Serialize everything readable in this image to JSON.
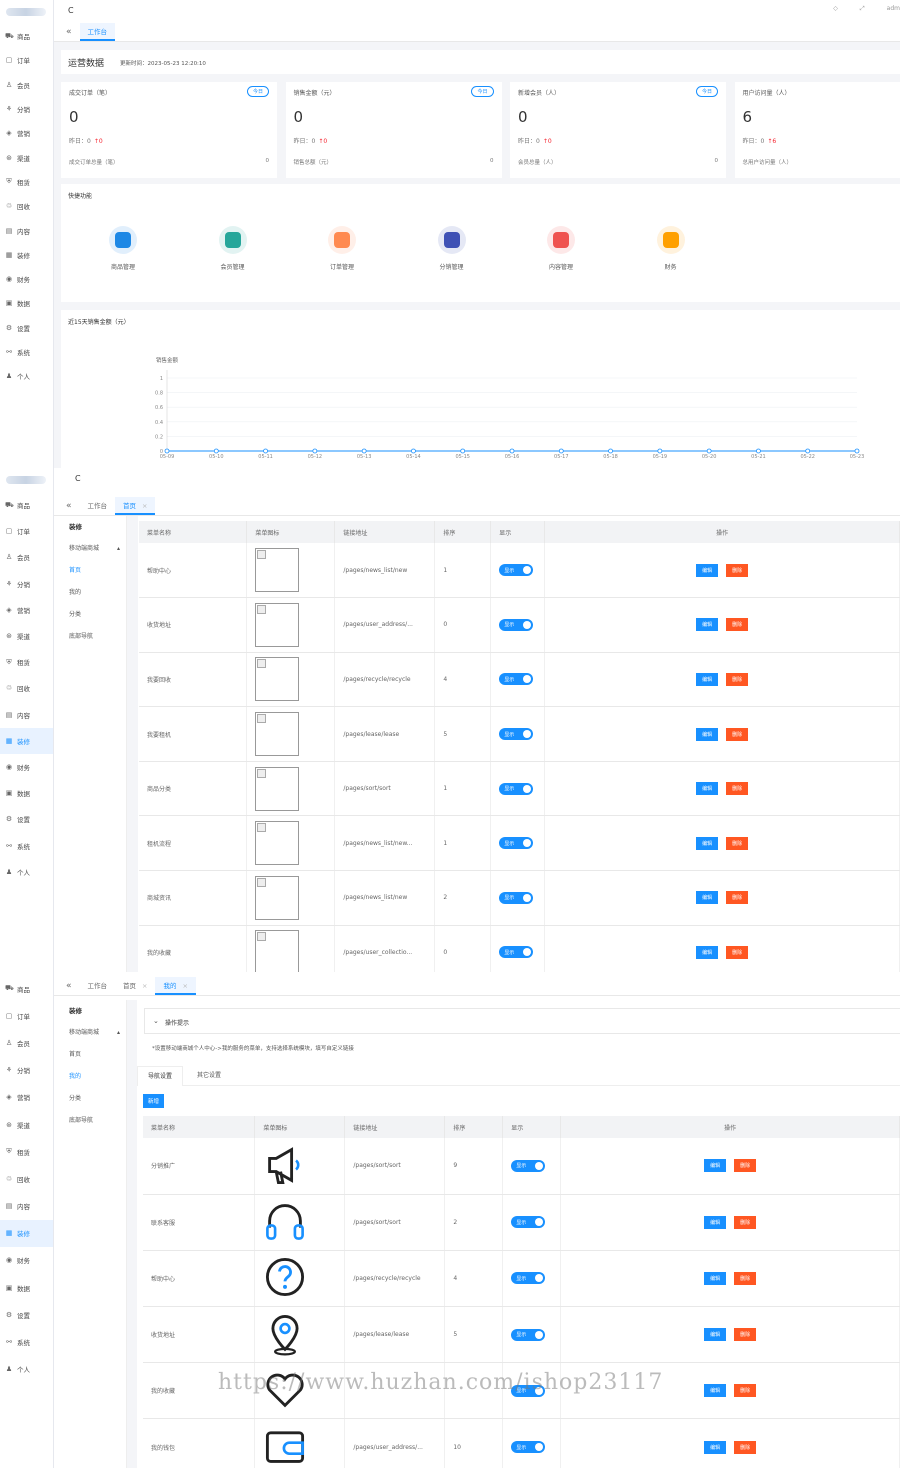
{
  "sidebar1": [
    "商品",
    "订单",
    "会员",
    "分销",
    "营销",
    "渠道",
    "租赁",
    "回收",
    "内容",
    "装修",
    "财务",
    "数据",
    "设置",
    "系统",
    "个人"
  ],
  "sidebar2": [
    "商品",
    "订单",
    "会员",
    "分销",
    "营销",
    "渠道",
    "租赁",
    "回收",
    "内容",
    "装修",
    "财务",
    "数据",
    "设置",
    "系统",
    "个人"
  ],
  "icons": [
    "cart-icon",
    "order-icon",
    "user-icon",
    "share-icon",
    "diamond-icon",
    "channel-icon",
    "shield-icon",
    "recycle-icon",
    "book-icon",
    "layout-icon",
    "wallet-icon",
    "data-icon",
    "gear-icon",
    "system-icon",
    "person-icon"
  ],
  "topbar": {
    "refresh": "C",
    "user": "adm",
    "fullscreen": "⤢",
    "tag": "◇"
  },
  "p1": {
    "tab": "工作台",
    "title": "运营数据",
    "updated": "更新时间：2023-05-23 12:20:10",
    "cards": [
      {
        "h": "成交订单（笔）",
        "badge": "今日",
        "v": "0",
        "s": "昨日：0",
        "d": "↑0",
        "f": "成交订单总量（笔）",
        "fv": "0"
      },
      {
        "h": "销售金额（元）",
        "badge": "今日",
        "v": "0",
        "s": "昨日：0",
        "d": "↑0",
        "f": "销售总额（元）",
        "fv": "0"
      },
      {
        "h": "新增会员（人）",
        "badge": "今日",
        "v": "0",
        "s": "昨日：0",
        "d": "↑0",
        "f": "会员总量（人）",
        "fv": "0"
      },
      {
        "h": "用户访问量（人）",
        "badge": "今日",
        "v": "6",
        "s": "昨日：0",
        "d": "↑6",
        "f": "总用户访问量（人）",
        "fv": ""
      }
    ],
    "quick_title": "快捷功能",
    "quick": [
      "商品管理",
      "会员管理",
      "订单管理",
      "分销管理",
      "内容管理",
      "财务"
    ],
    "quick_colors": [
      "#1e88e5",
      "#26a69a",
      "#ff8a50",
      "#3f51b5",
      "#ef5350",
      "#ffa000"
    ],
    "chart_title": "近15天销售金额（元）"
  },
  "chart_data": {
    "type": "line",
    "title": "近15天销售金额（元）",
    "legend": "销售金额",
    "categories": [
      "05-09",
      "05-10",
      "05-11",
      "05-12",
      "05-13",
      "05-14",
      "05-15",
      "05-16",
      "05-17",
      "05-18",
      "05-19",
      "05-20",
      "05-21",
      "05-22",
      "05-23"
    ],
    "values": [
      0,
      0,
      0,
      0,
      0,
      0,
      0,
      0,
      0,
      0,
      0,
      0,
      0,
      0,
      0
    ],
    "yticks": [
      "1",
      "0.8",
      "0.6",
      "0.4",
      "0.2",
      "0"
    ],
    "ylim": [
      0,
      1
    ],
    "color": "#1890ff"
  },
  "p2": {
    "tabs": [
      {
        "label": "工作台"
      },
      {
        "label": "首页",
        "close": "×"
      }
    ],
    "sub": {
      "head": "装修",
      "group": "移动端商城",
      "items": [
        "首页",
        "我的",
        "分类",
        "底部导航"
      ]
    },
    "headers": [
      "菜单名称",
      "菜单图标",
      "链接地址",
      "排序",
      "显示",
      "操作"
    ],
    "rows": [
      {
        "name": "帮助中心",
        "link": "/pages/news_list/new",
        "sort": "1"
      },
      {
        "name": "收货地址",
        "link": "/pages/user_address/...",
        "sort": "0"
      },
      {
        "name": "我要回收",
        "link": "/pages/recycle/recycle",
        "sort": "4"
      },
      {
        "name": "我要租机",
        "link": "/pages/lease/lease",
        "sort": "5"
      },
      {
        "name": "商品分类",
        "link": "/pages/sort/sort",
        "sort": "1"
      },
      {
        "name": "租机流程",
        "link": "/pages/news_list/new...",
        "sort": "1"
      },
      {
        "name": "商城资讯",
        "link": "/pages/news_list/new",
        "sort": "2"
      },
      {
        "name": "我的收藏",
        "link": "/pages/user_collectio...",
        "sort": "0"
      }
    ],
    "toggle": "显示",
    "edit": "编辑",
    "del": "删除"
  },
  "p3": {
    "tabs": [
      {
        "label": "工作台"
      },
      {
        "label": "首页",
        "close": "×"
      },
      {
        "label": "我的",
        "close": "×"
      }
    ],
    "sub": {
      "head": "装修",
      "group": "移动端商城",
      "items": [
        "首页",
        "我的",
        "分类",
        "底部导航"
      ]
    },
    "tip_title": "操作提示",
    "tip": "*设置移动端商城个人中心->我的服务的菜单，支持选择系统模块，填写自定义链接",
    "subtabs": [
      "导航设置",
      "其它设置"
    ],
    "add": "新增",
    "headers": [
      "菜单名称",
      "菜单图标",
      "链接地址",
      "排序",
      "显示",
      "操作"
    ],
    "rows": [
      {
        "name": "分销推广",
        "icon": "megaphone-icon",
        "link": "/pages/sort/sort",
        "sort": "9"
      },
      {
        "name": "联系客服",
        "icon": "headset-icon",
        "link": "/pages/sort/sort",
        "sort": "2"
      },
      {
        "name": "帮助中心",
        "icon": "question-icon",
        "link": "/pages/recycle/recycle",
        "sort": "4"
      },
      {
        "name": "收货地址",
        "icon": "location-icon",
        "link": "/pages/lease/lease",
        "sort": "5"
      },
      {
        "name": "我的收藏",
        "icon": "heart-icon",
        "link": "",
        "sort": ""
      },
      {
        "name": "我的钱包",
        "icon": "wallet-icon",
        "link": "/pages/user_address/...",
        "sort": "10"
      }
    ],
    "toggle": "显示",
    "edit": "编辑",
    "del": "删除"
  },
  "watermark": "https://www.huzhan.com/ishop23117"
}
